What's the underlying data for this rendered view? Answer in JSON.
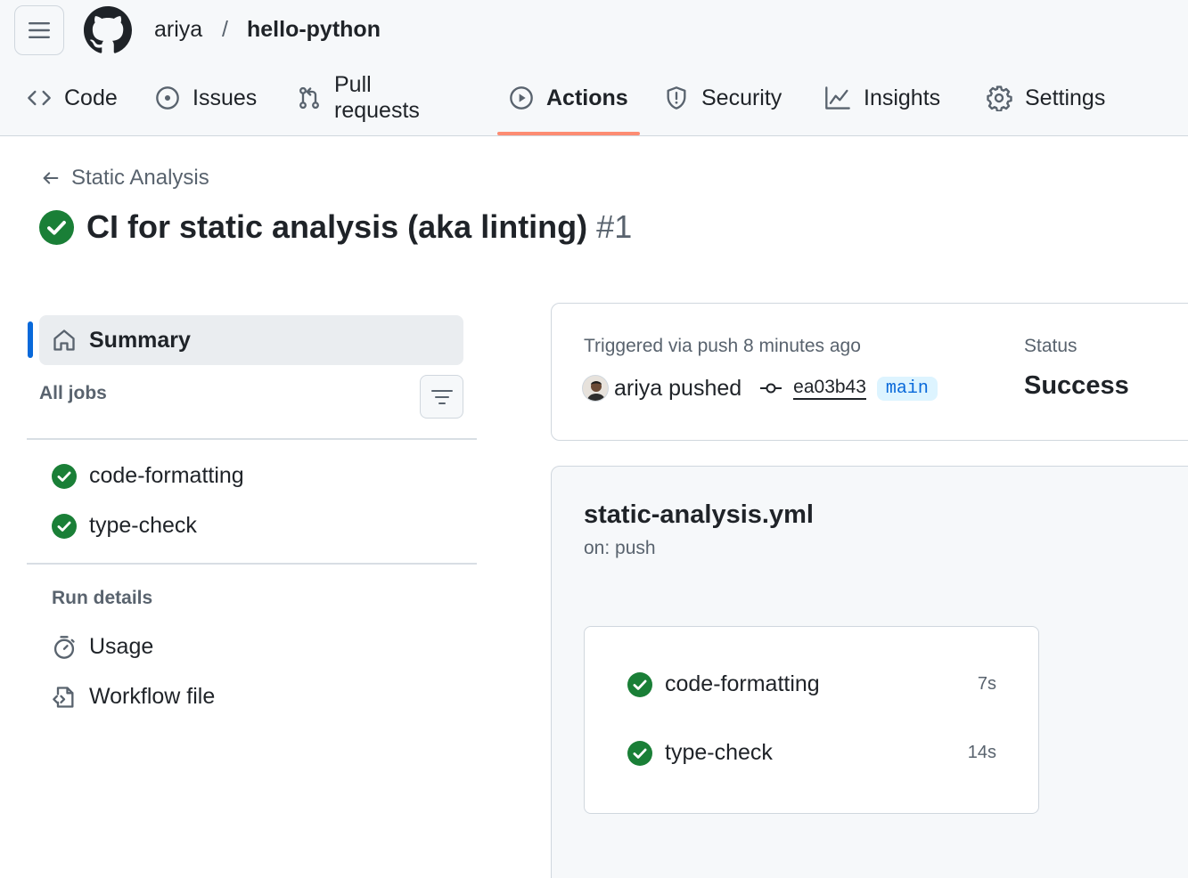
{
  "header": {
    "owner": "ariya",
    "separator": "/",
    "repo": "hello-python"
  },
  "tabs": [
    {
      "label": "Code",
      "icon": "code-icon",
      "active": false
    },
    {
      "label": "Issues",
      "icon": "issue-opened-icon",
      "active": false
    },
    {
      "label": "Pull requests",
      "icon": "pull-request-icon",
      "active": false
    },
    {
      "label": "Actions",
      "icon": "play-icon",
      "active": true
    },
    {
      "label": "Security",
      "icon": "shield-icon",
      "active": false
    },
    {
      "label": "Insights",
      "icon": "graph-icon",
      "active": false
    },
    {
      "label": "Settings",
      "icon": "gear-icon",
      "active": false
    }
  ],
  "run": {
    "back_label": "Static Analysis",
    "title": "CI for static analysis (aka linting)",
    "number": "#1",
    "status_icon": "check-circle-fill-icon"
  },
  "sidebar": {
    "summary_label": "Summary",
    "all_jobs_label": "All jobs",
    "jobs": [
      {
        "name": "code-formatting",
        "status": "success"
      },
      {
        "name": "type-check",
        "status": "success"
      }
    ],
    "run_details_label": "Run details",
    "details": [
      {
        "label": "Usage",
        "icon": "stopwatch-icon"
      },
      {
        "label": "Workflow file",
        "icon": "file-code-icon"
      }
    ]
  },
  "trigger": {
    "text": "Triggered via push 8 minutes ago",
    "actor_action": "ariya pushed",
    "commit": "ea03b43",
    "branch": "main",
    "status_label": "Status",
    "status_value": "Success"
  },
  "workflow": {
    "file": "static-analysis.yml",
    "on": "on: push",
    "jobs": [
      {
        "name": "code-formatting",
        "duration": "7s"
      },
      {
        "name": "type-check",
        "duration": "14s"
      }
    ]
  },
  "colors": {
    "success": "#1a7f37",
    "accent": "#0969da",
    "tab_underline": "#fd8c73"
  }
}
